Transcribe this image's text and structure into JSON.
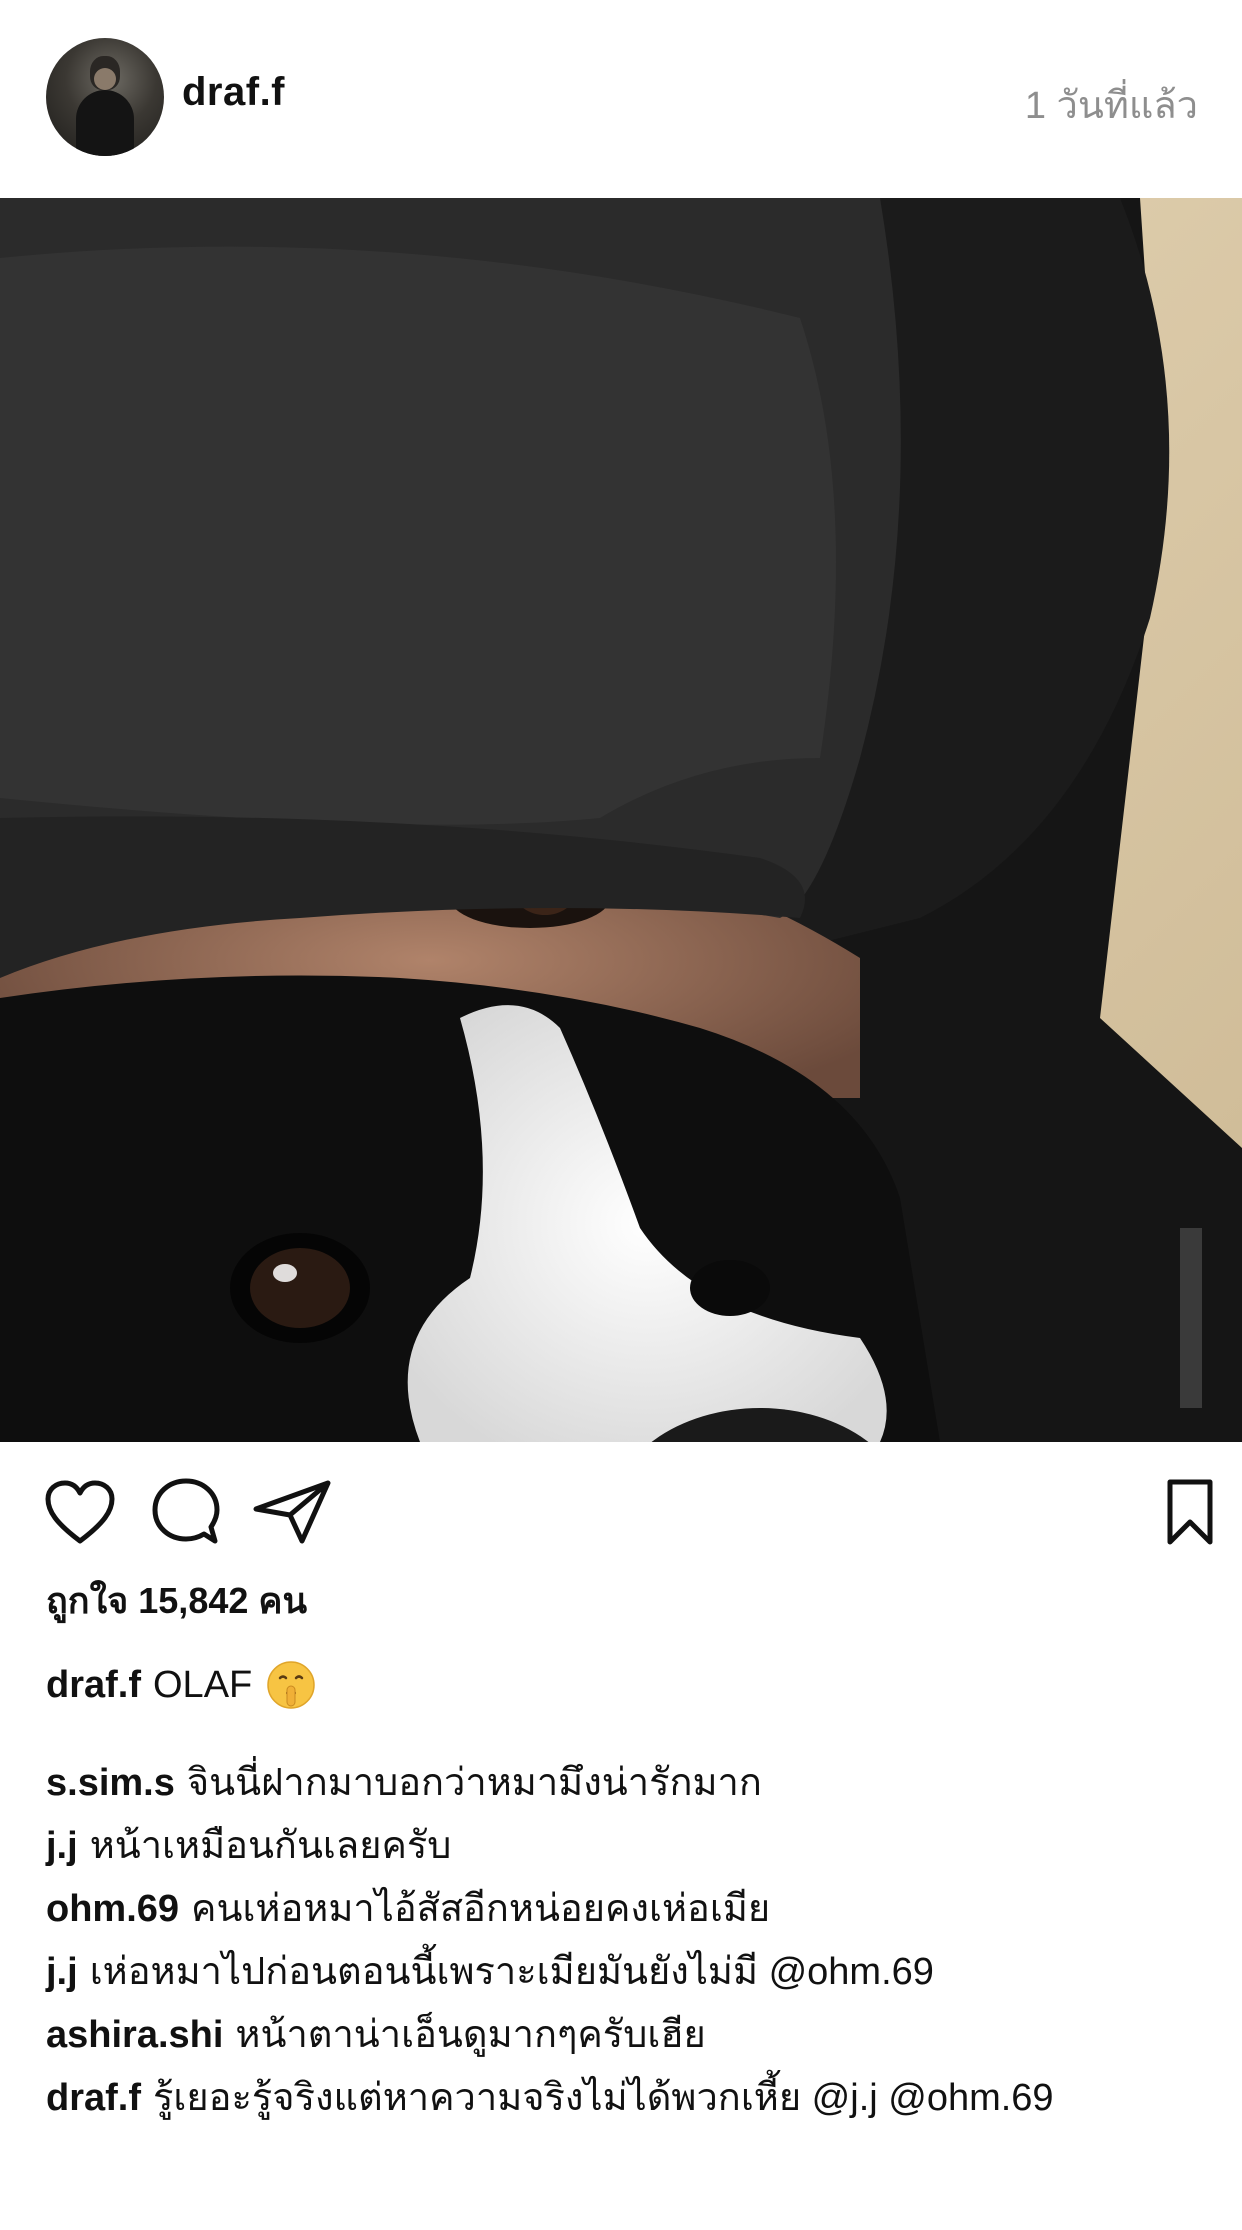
{
  "post": {
    "username": "draf.f",
    "time_ago": "1 วันที่แล้ว"
  },
  "icons": {
    "like": "heart-icon",
    "comment": "comment-bubble-icon",
    "share": "paper-plane-icon",
    "save": "bookmark-icon",
    "caption_emoji": "shushing-face-emoji"
  },
  "likes": {
    "text": "ถูกใจ 15,842 คน"
  },
  "caption": {
    "user": "draf.f",
    "text": "OLAF"
  },
  "comments": [
    {
      "user": "s.sim.s",
      "text": "จินนี่ฝากมาบอกว่าหมามึงน่ารักมาก"
    },
    {
      "user": "j.j",
      "text": "หน้าเหมือนกันเลยครับ"
    },
    {
      "user": "ohm.69",
      "text": "คนเห่อหมาไอ้สัสอีกหน่อยคงเห่อเมีย"
    },
    {
      "user": "j.j",
      "text": "เห่อหมาไปก่อนตอนนี้เพราะเมียมันยังไม่มี @ohm.69"
    },
    {
      "user": "ashira.shi",
      "text": "หน้าตาน่าเอ็นดูมากๆครับเฮีย"
    },
    {
      "user": "draf.f",
      "text": "รู้เยอะรู้จริงแต่หาความจริงไม่ได้พวกเหี้ย @j.j @ohm.69"
    }
  ]
}
